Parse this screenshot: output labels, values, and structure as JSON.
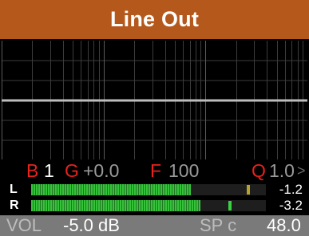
{
  "title": "Line Out",
  "params": {
    "band_label": "B",
    "band_value": "1",
    "gain_label": "G",
    "gain_value": "+0.0",
    "freq_label": "F",
    "freq_value": "100",
    "q_label": "Q",
    "q_value": "1.0",
    "next_glyph": ">"
  },
  "meters": [
    {
      "channel": "L",
      "level_fraction": 0.68,
      "peak_fraction": 0.92,
      "peak_color": "#b8a32a",
      "value": "-1.2"
    },
    {
      "channel": "R",
      "level_fraction": 0.72,
      "peak_fraction": 0.84,
      "peak_color": "#39d23e",
      "value": "-3.2"
    }
  ],
  "bottom": {
    "vol_label": "VOL",
    "vol_value": "-5.0 dB",
    "sp_label": "SP c",
    "sp_value": "48.0"
  },
  "colors": {
    "title_bg": "#b5581c",
    "accent_red": "#e8221d",
    "meter_green": "#36c23a",
    "bottom_bg": "#7a7a7a"
  }
}
